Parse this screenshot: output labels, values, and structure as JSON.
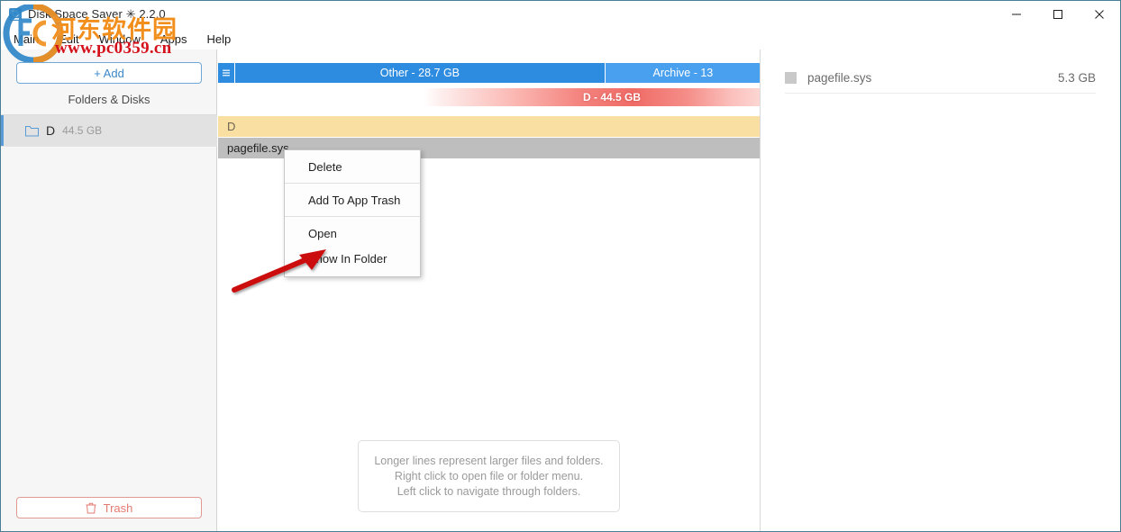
{
  "window": {
    "title": "Disk Space Saver ✳ 2.2.0",
    "app_icon": "disk-drive-icon",
    "minimize_label": "–",
    "maximize_label": "□",
    "close_label": "✕"
  },
  "watermark": {
    "chinese_text": "河东软件园",
    "url_text": "www.pc0359.cn",
    "logo_icon": "pc0359-logo-icon"
  },
  "menubar": {
    "items": [
      {
        "label": "Main"
      },
      {
        "label": "Edit"
      },
      {
        "label": "Window"
      },
      {
        "label": "Apps"
      },
      {
        "label": "Help"
      }
    ]
  },
  "sidebar": {
    "add_button": {
      "label": "+ Add",
      "icon": "plus-icon"
    },
    "section_label": "Folders & Disks",
    "disks": [
      {
        "name": "D",
        "size": "44.5 GB",
        "icon": "folder-icon",
        "selected": true
      }
    ],
    "trash_button": {
      "label": "Trash",
      "icon": "trash-icon"
    }
  },
  "main": {
    "menu_icon": "hamburger-icon",
    "categories": [
      {
        "label": "Other - 28.7 GB",
        "color": "#2e8ce0"
      },
      {
        "label": "Archive - 13",
        "color": "#49a0ee"
      }
    ],
    "total_bar": {
      "label": "D - 44.5 GB",
      "color": "#ef6b66"
    },
    "rows": [
      {
        "label": "D",
        "type": "folder",
        "color": "#fadfa3"
      },
      {
        "label": "pagefile.sys",
        "type": "file",
        "color": "#bebebe"
      }
    ],
    "hint": {
      "line1": "Longer lines represent larger files and folders.",
      "line2": "Right click to open file or folder menu.",
      "line3": "Left click to navigate through folders."
    }
  },
  "context_menu": {
    "items": [
      {
        "label": "Delete"
      },
      {
        "label": "Add To App Trash"
      },
      {
        "label": "Open"
      },
      {
        "label": "Show In Folder"
      }
    ]
  },
  "annotation": {
    "arrow_icon": "red-arrow-icon",
    "arrow_color": "#cc1111"
  },
  "right_panel": {
    "entries": [
      {
        "name": "pagefile.sys",
        "size": "5.3 GB",
        "swatch_color": "#c9c9c9"
      }
    ]
  }
}
